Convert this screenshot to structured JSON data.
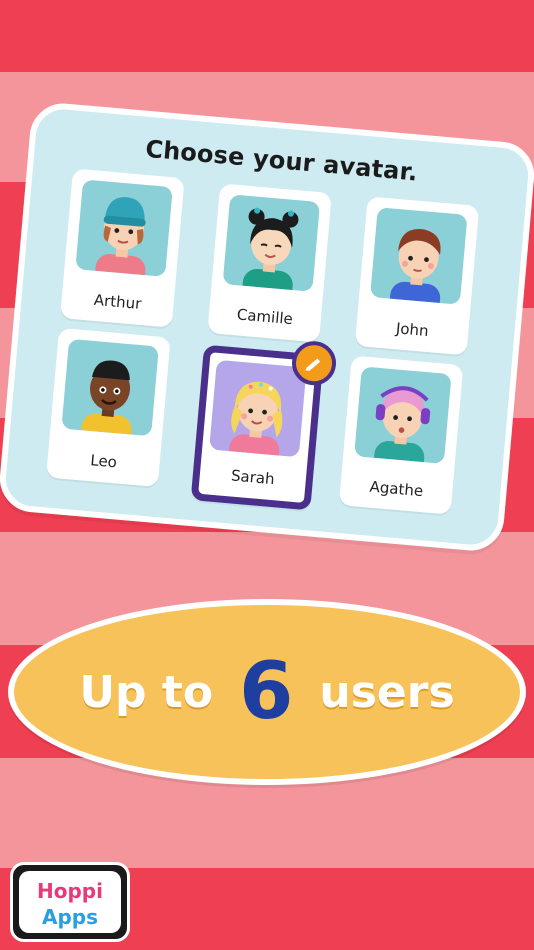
{
  "card": {
    "title": "Choose your avatar.",
    "avatars": [
      {
        "name": "Arthur"
      },
      {
        "name": "Camille"
      },
      {
        "name": "John"
      },
      {
        "name": "Leo"
      },
      {
        "name": "Sarah",
        "selected": true
      },
      {
        "name": "Agathe"
      }
    ]
  },
  "banner": {
    "prefix": "Up to",
    "number": "6",
    "suffix": "users"
  },
  "logo": {
    "line1": "Hoppi",
    "line2": "Apps"
  },
  "colors": {
    "stripe_dark": "#ef3f52",
    "stripe_light": "#f4959c",
    "card_bg": "#cdebf0",
    "selected_border": "#4b2f8c",
    "edit_badge": "#f39c1c",
    "oval_fill": "#f7c25a",
    "number_color": "#1f3fa0"
  },
  "icons": {
    "edit": "pencil-icon"
  }
}
